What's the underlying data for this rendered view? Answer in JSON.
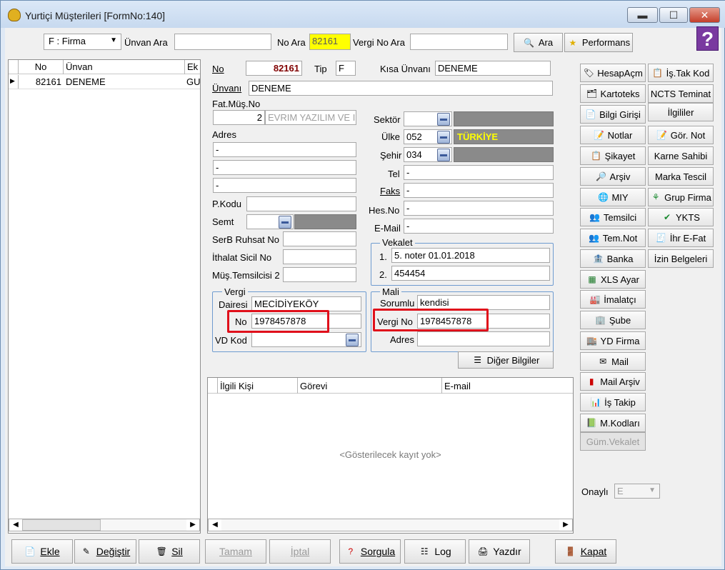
{
  "window": {
    "title": "Yurtiçi Müşterileri [FormNo:140]",
    "help_glyph": "?"
  },
  "search": {
    "type_select": "F : Firma",
    "unvan_label": "Ünvan Ara",
    "unvan_value": "",
    "no_label": "No Ara",
    "no_value": "82161",
    "vergino_label": "Vergi No Ara",
    "vergino_value": "",
    "ara_button": "Ara",
    "performans_button": "Performans"
  },
  "list": {
    "columns": [
      "No",
      "Ünvan",
      "Ek"
    ],
    "rows": [
      {
        "no": "82161",
        "unvan": "DENEME",
        "ek": "GU"
      }
    ]
  },
  "form": {
    "no_label": "No",
    "no_value": "82161",
    "tip_label": "Tip",
    "tip_value": "F",
    "kisa_unvan_label": "Kısa Ünvanı",
    "kisa_unvan_value": "DENEME",
    "unvan_label": "Ünvanı",
    "unvan_value": "DENEME",
    "fatmus_label": "Fat.Müş.No",
    "fatmus_no": "2",
    "fatmus_name": "EVRIM YAZILIM VE I",
    "adres_label": "Adres",
    "adres1": "-",
    "adres2": "-",
    "adres3": "-",
    "pkodu_label": "P.Kodu",
    "pkodu_value": "",
    "semt_label": "Semt",
    "semt_value": "",
    "serb_label": "SerB Ruhsat No",
    "serb_value": "",
    "ithalat_label": "İthalat Sicil No",
    "ithalat_value": "",
    "mustem_label": "Müş.Temsilcisi 2",
    "mustem_value": "",
    "sektor_label": "Sektör",
    "sektor_code": "",
    "sektor_name": "",
    "ulke_label": "Ülke",
    "ulke_code": "052",
    "ulke_name": "TÜRKİYE",
    "sehir_label": "Şehir",
    "sehir_code": "034",
    "sehir_name": "",
    "tel_label": "Tel",
    "tel_value": "-",
    "faks_label": "Faks",
    "faks_value": "-",
    "hesno_label": "Hes.No",
    "hesno_value": "-",
    "email_label": "E-Mail",
    "email_value": "-",
    "vekalet_title": "Vekalet",
    "vekalet_1_n": "1.",
    "vekalet_1": "5. noter 01.01.2018",
    "vekalet_2_n": "2.",
    "vekalet_2": "454454",
    "vergi_title": "Vergi",
    "vd_label": "Dairesi",
    "vd_value": "MECİDİYEKÖY",
    "vno_label": "No",
    "vno_value": "1978457878",
    "vdkod_label": "VD Kod",
    "vdkod_value": "",
    "mali_title": "Mali",
    "sorumlu_label": "Sorumlu",
    "sorumlu_value": "kendisi",
    "mali_vno_label": "Vergi No",
    "mali_vno_value": "1978457878",
    "mali_adres_label": "Adres",
    "mali_adres_value": "",
    "diger_button": "Diğer Bilgiler"
  },
  "contacts": {
    "columns": [
      "İlgili Kişi",
      "Görevi",
      "E-mail"
    ],
    "empty": "<Gösterilecek kayıt yok>"
  },
  "right": {
    "col1": [
      "HesapAçm",
      "Kartoteks",
      "Bilgi Girişi",
      "Notlar",
      "Şikayet",
      "Arşiv",
      "MIY",
      "Temsilci",
      "Tem.Not",
      "Banka",
      "XLS Ayar",
      "İmalatçı",
      "Şube",
      "YD Firma",
      "Mail",
      "Mail Arşiv",
      "İş Takip",
      "M.Kodları",
      "Güm.Vekalet"
    ],
    "col2": [
      "İş.Tak Kod",
      "NCTS Teminat",
      "İlgililer",
      "Gör. Not",
      "Karne Sahibi",
      "Marka Tescil",
      "Grup Firma",
      "YKTS",
      "İhr E-Fat",
      "İzin Belgeleri"
    ],
    "onayli_label": "Onaylı",
    "onayli_value": "E"
  },
  "bottom": {
    "ekle": "Ekle",
    "degistir": "Değiştir",
    "sil": "Sil",
    "tamam": "Tamam",
    "iptal": "İptal",
    "sorgula": "Sorgula",
    "log": "Log",
    "yazdir": "Yazdır",
    "kapat": "Kapat"
  },
  "colors": {
    "no_highlight": "#ffff00",
    "ulke_text": "#ffff00",
    "no_value_red": "#800000",
    "callout": "#e0101b"
  }
}
